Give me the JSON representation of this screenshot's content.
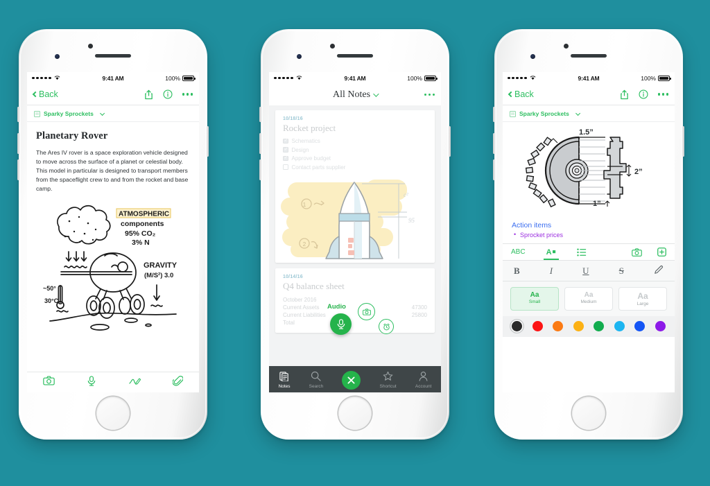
{
  "theme": {
    "background": "#1f8f9e",
    "accent": "#2dbe60",
    "tabbar_bg": "#3f4648"
  },
  "status_bar": {
    "time": "9:41 AM",
    "battery": "100%",
    "signal_dots": 5,
    "wifi_icon": "wifi-icon"
  },
  "phone1": {
    "nav": {
      "back_label": "Back",
      "share_icon": "share-icon",
      "info_icon": "info-icon",
      "more_icon": "more-icon"
    },
    "notebook": {
      "name": "Sparky Sprockets",
      "icon": "notebook-icon",
      "chevron": "chevron-down-icon"
    },
    "note": {
      "title": "Planetary Rover",
      "body": "The Ares IV rover is a space exploration vehicle designed to move across the surface of a planet or celestial body. This model in particular is designed to transport members from the spaceflight crew to and from the rocket and base camp."
    },
    "sketch": {
      "label_atmospheric": "ATMOSPHERIC",
      "label_components": "components",
      "label_co2": "95% CO2",
      "label_n": "3% N",
      "label_gravity": "GRAVITY",
      "label_gravity_units": "(M/S²) 3.0",
      "label_temp_top": "~50°",
      "label_temp_bottom": "30°C",
      "highlight_color": "#f5c242"
    },
    "attach_toolbar": [
      {
        "icon": "camera-icon"
      },
      {
        "icon": "microphone-icon"
      },
      {
        "icon": "handwriting-icon"
      },
      {
        "icon": "paperclip-icon"
      }
    ]
  },
  "phone2": {
    "nav": {
      "title": "All Notes",
      "chevron": "chevron-down-icon",
      "more_icon": "more-icon"
    },
    "cards": [
      {
        "date": "10/18/16",
        "title": "Rocket project",
        "checklist": [
          {
            "label": "Schematics",
            "checked": true
          },
          {
            "label": "Design",
            "checked": true
          },
          {
            "label": "Approve budget",
            "checked": true
          },
          {
            "label": "Contact parts supplier",
            "checked": false
          }
        ],
        "sketch_note_1": "1",
        "sketch_note_2": "2"
      },
      {
        "date": "10/14/16",
        "title": "Q4 balance sheet",
        "subtitle": "October 2016",
        "rows": [
          {
            "label": "Current Assets",
            "value": "47300"
          },
          {
            "label": "Current Liabilities",
            "value": "25800"
          },
          {
            "label": "Total",
            "value": ""
          }
        ]
      }
    ],
    "fabs": {
      "audio_label": "Audio",
      "audio_icon": "microphone-icon",
      "camera_icon": "camera-icon",
      "reminder_icon": "alarm-icon"
    },
    "tabbar": [
      {
        "label": "Notes",
        "icon": "notes-icon",
        "active": true
      },
      {
        "label": "Search",
        "icon": "search-icon",
        "active": false
      },
      {
        "label": "",
        "icon": "close-icon",
        "active": false
      },
      {
        "label": "Shortcut",
        "icon": "star-icon",
        "active": false
      },
      {
        "label": "Account",
        "icon": "person-icon",
        "active": false
      }
    ]
  },
  "phone3": {
    "nav": {
      "back_label": "Back",
      "share_icon": "share-icon",
      "info_icon": "info-icon",
      "more_icon": "more-icon"
    },
    "notebook": {
      "name": "Sparky Sprockets",
      "icon": "notebook-icon",
      "chevron": "chevron-down-icon"
    },
    "diagram": {
      "dim_top": "1.5”",
      "dim_right": "2”",
      "dim_bottom": "1”"
    },
    "action_items": {
      "title": "Action items",
      "items": [
        "Sprocket prices"
      ],
      "title_color": "#3b6ef0",
      "item_color": "#9b2fe0"
    },
    "format_tabs": [
      {
        "label": "ABC",
        "icon": "spellcheck-icon",
        "selected": false
      },
      {
        "label": "A",
        "icon": "text-style-icon",
        "selected": true
      },
      {
        "label": "",
        "icon": "list-icon",
        "selected": false
      },
      {
        "label": "",
        "icon": "camera-icon",
        "selected": false
      },
      {
        "label": "",
        "icon": "plus-box-icon",
        "selected": false
      }
    ],
    "style_buttons": [
      {
        "label": "B",
        "name": "bold-button"
      },
      {
        "label": "I",
        "name": "italic-button"
      },
      {
        "label": "U",
        "name": "underline-button"
      },
      {
        "label": "S",
        "name": "strikethrough-button"
      },
      {
        "label": "",
        "name": "highlighter-icon"
      }
    ],
    "sizes": [
      {
        "aa": "Aa",
        "label": "Small",
        "selected": true
      },
      {
        "aa": "Aa",
        "label": "Medium",
        "selected": false
      },
      {
        "aa": "Aa",
        "label": "Large",
        "selected": false
      }
    ],
    "colors": [
      {
        "hex": "#2b2b2b",
        "selected": true
      },
      {
        "hex": "#fc1414",
        "selected": false
      },
      {
        "hex": "#fb7a13",
        "selected": false
      },
      {
        "hex": "#fcb114",
        "selected": false
      },
      {
        "hex": "#12ac4e",
        "selected": false
      },
      {
        "hex": "#1cb5f1",
        "selected": false
      },
      {
        "hex": "#1455f5",
        "selected": false
      },
      {
        "hex": "#8d1ae8",
        "selected": false
      }
    ]
  }
}
